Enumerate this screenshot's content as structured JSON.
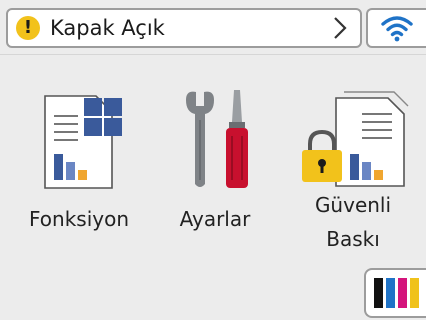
{
  "status": {
    "message": "Kapak Açık",
    "alert_icon": "warning-icon",
    "alert_color": "#f2c21b"
  },
  "wifi": {
    "icon": "wifi-icon",
    "color": "#1f73c7"
  },
  "tiles": [
    {
      "label": "Fonksiyon",
      "icon": "function-icon"
    },
    {
      "label": "Ayarlar",
      "icon": "settings-icon"
    },
    {
      "label_line1": "Güvenli",
      "label_line2": "Baskı",
      "icon": "secure-print-icon"
    }
  ],
  "ink": {
    "icon": "ink-levels-icon",
    "colors": [
      "#111111",
      "#1f73c7",
      "#d4147c",
      "#f0c21b"
    ]
  }
}
